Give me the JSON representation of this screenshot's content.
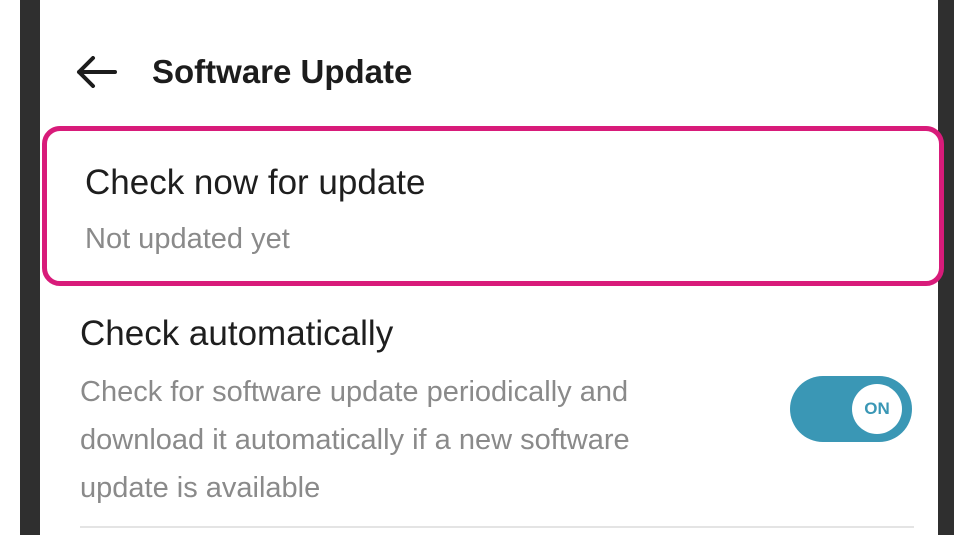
{
  "app_bar": {
    "back_icon": "arrow-left-icon",
    "title": "Software Update"
  },
  "settings": {
    "check_now": {
      "title": "Check now for update",
      "subtitle": "Not updated yet",
      "highlight_color": "#d81b7a"
    },
    "check_auto": {
      "title": "Check automatically",
      "description": "Check for software update periodically and download it automatically if a new software update is available",
      "toggle_label": "ON",
      "toggle_state": true,
      "toggle_color": "#3a97b5"
    }
  }
}
